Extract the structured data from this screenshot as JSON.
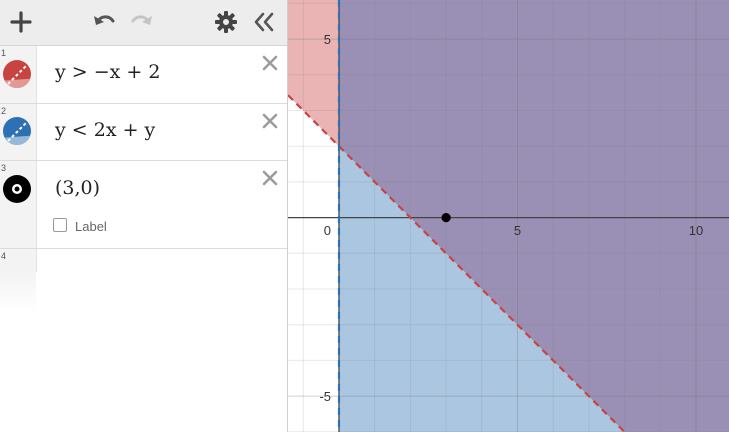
{
  "toolbar": {
    "add_icon": "plus-icon",
    "undo_icon": "undo-icon",
    "redo_icon": "redo-icon",
    "settings_icon": "gear-icon",
    "collapse_icon": "double-chevron-left-icon"
  },
  "expressions": [
    {
      "index": "1",
      "latex": "y > −x + 2",
      "color": "#c74440"
    },
    {
      "index": "2",
      "latex": "y < 2x + y",
      "color": "#2d70b3"
    },
    {
      "index": "3",
      "latex": "(3,0)",
      "color": "#000000",
      "label_text": "Label",
      "label_checked": false
    },
    {
      "index": "4",
      "latex": ""
    }
  ],
  "graph": {
    "x_ticks": [
      "0",
      "5",
      "10"
    ],
    "y_ticks": [
      "5",
      "-5"
    ],
    "point": {
      "x": 3,
      "y": 0
    },
    "colors": {
      "red_fill": "#c74440",
      "blue_fill": "#2d70b3",
      "overlap": "#9a90b8"
    }
  }
}
